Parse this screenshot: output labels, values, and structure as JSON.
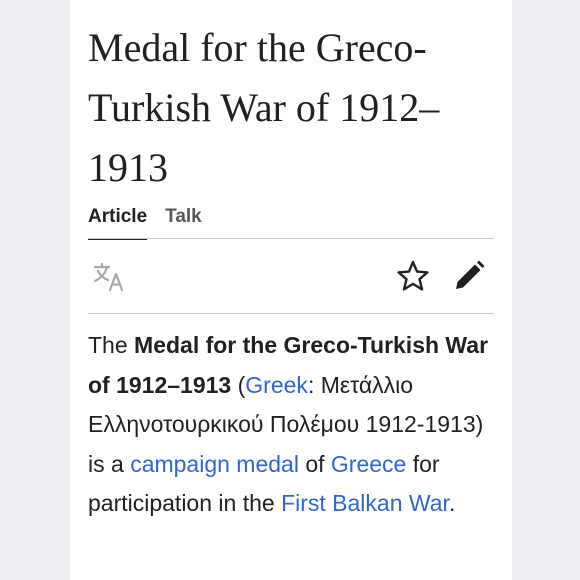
{
  "article": {
    "title": "Medal for the Greco-Turkish War of 1912–1913"
  },
  "tabs": [
    {
      "label": "Article",
      "active": true
    },
    {
      "label": "Talk",
      "active": false
    }
  ],
  "toolbar": {
    "icons": [
      "translate-icon",
      "star-icon",
      "edit-pencil-icon"
    ]
  },
  "lead": {
    "t1": "The ",
    "bold": "Medal for the Greco-Turkish War of 1912–1913",
    "t2": " (",
    "link_greek": "Greek",
    "t3": ": Μετάλλιο Ελληνοτουρκικού Πολέμου 1912-1913) is a ",
    "link_campaign": "campaign medal",
    "t4": " of ",
    "link_greece": "Greece",
    "t5": " for participation in the ",
    "link_war": "First Balkan War",
    "t6": "."
  },
  "colors": {
    "link": "#3366cc",
    "text": "#202122",
    "muted": "#54595d",
    "divider": "#c8ccd1"
  }
}
